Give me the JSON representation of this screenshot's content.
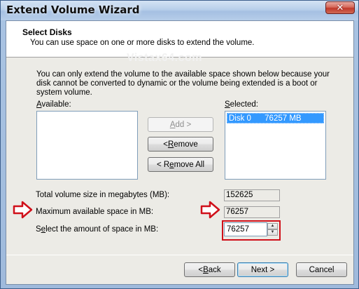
{
  "window": {
    "title": "Extend Volume Wizard",
    "close_glyph": "✕"
  },
  "header": {
    "title": "Select Disks",
    "subtitle": "You can use space on one or more disks to extend the volume."
  },
  "watermark": "Vistax64.com",
  "intro": "You can only extend the volume to the available space shown below because your disk cannot be converted to dynamic or the volume being extended is a boot or system volume.",
  "available": {
    "label_prefix": "A",
    "label_rest": "vailable:",
    "items": []
  },
  "selected": {
    "label_prefix": "S",
    "label_rest": "elected:",
    "items": [
      {
        "disk": "Disk 0",
        "size": "76257 MB"
      }
    ]
  },
  "buttons": {
    "add": {
      "prefix": "",
      "mnemonic": "A",
      "rest": "dd >"
    },
    "remove": {
      "prefix": "< ",
      "mnemonic": "R",
      "rest": "emove"
    },
    "remove_all": {
      "prefix": "< R",
      "mnemonic": "e",
      "rest": "move All"
    },
    "back": {
      "prefix": "< ",
      "mnemonic": "B",
      "rest": "ack"
    },
    "next": "Next >",
    "cancel": "Cancel"
  },
  "fields": {
    "total_label": "Total volume size in megabytes (MB):",
    "total_value": "152625",
    "max_label": "Maximum available space in MB:",
    "max_value": "76257",
    "amount_label_prefix": "S",
    "amount_label_mnemonic": "e",
    "amount_label_rest": "lect the amount of space in MB:",
    "amount_value": "76257"
  },
  "colors": {
    "highlight": "#d0101a",
    "selection": "#3399ff"
  },
  "icons": {
    "arrow": "right-arrow-annotation",
    "spin_up": "▲",
    "spin_down": "▼"
  }
}
